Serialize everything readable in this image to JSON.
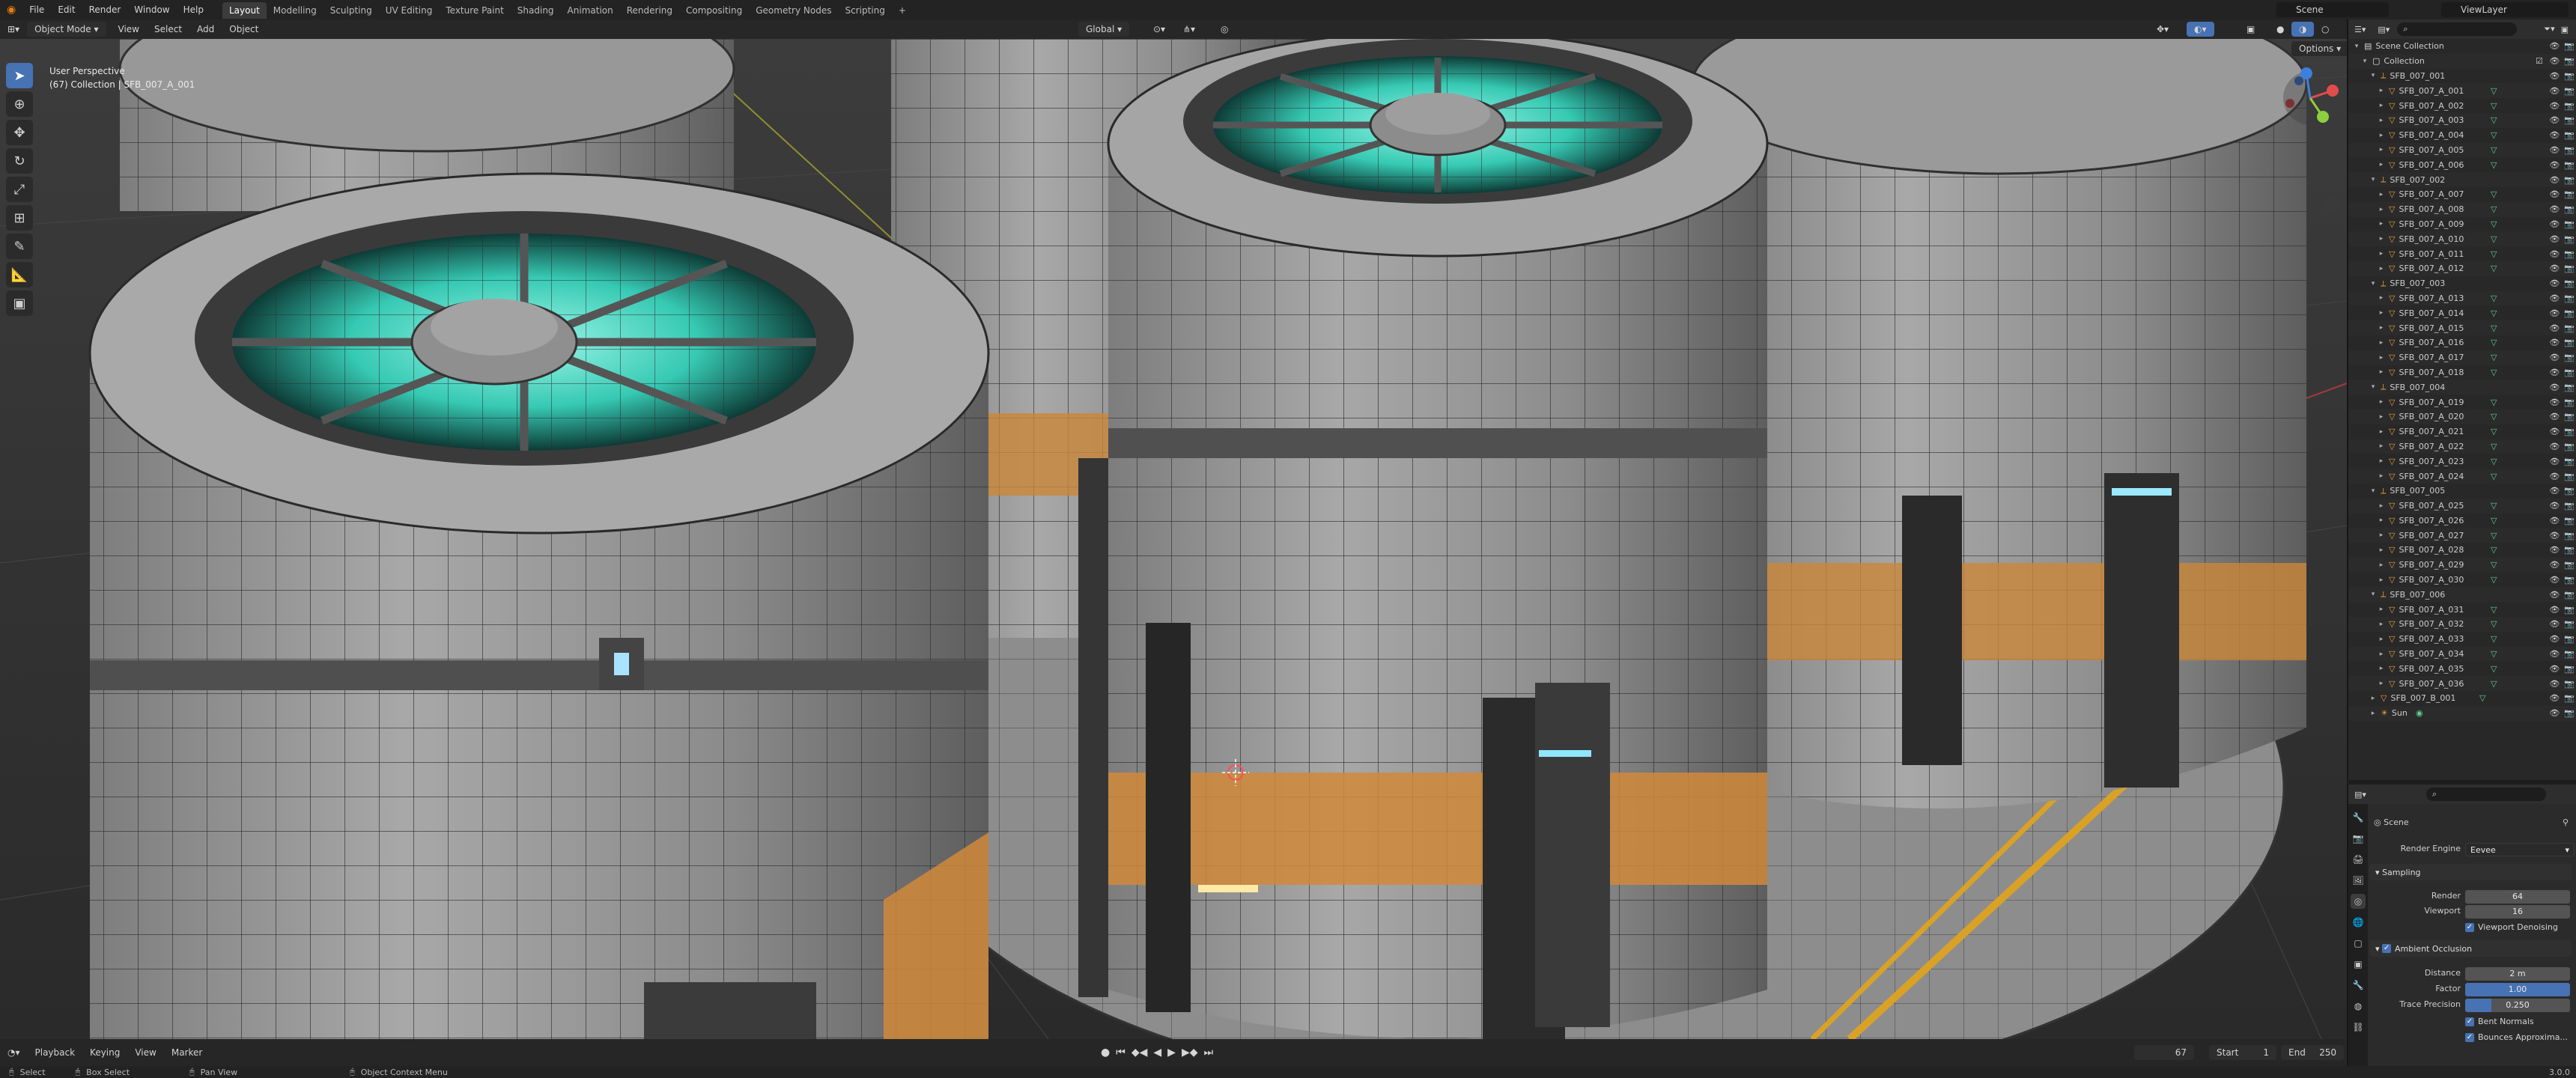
{
  "topbar": {
    "menus": [
      "File",
      "Edit",
      "Render",
      "Window",
      "Help"
    ],
    "workspaces": [
      "Layout",
      "Modelling",
      "Sculpting",
      "UV Editing",
      "Texture Paint",
      "Shading",
      "Animation",
      "Rendering",
      "Compositing",
      "Geometry Nodes",
      "Scripting"
    ],
    "active_workspace": "Layout",
    "add_workspace": "+",
    "scene": "Scene",
    "view_layer": "ViewLayer"
  },
  "viewport_header": {
    "mode": "Object Mode",
    "menus": [
      "View",
      "Select",
      "Add",
      "Object"
    ],
    "transform_orientation": "Global",
    "options": "Options"
  },
  "viewport": {
    "perspective": "User Perspective",
    "collection_info": "(67) Collection | SFB_007_A_001"
  },
  "timeline": {
    "menus": [
      "Playback",
      "Keying",
      "View",
      "Marker"
    ],
    "current_frame": "67",
    "start_label": "Start",
    "start": "1",
    "end_label": "End",
    "end": "250"
  },
  "statusbar": {
    "select": "Select",
    "box_select": "Box Select",
    "pan_view": "Pan View",
    "context_menu": "Object Context Menu",
    "version": "3.0.0"
  },
  "outliner": {
    "scene_collection": "Scene Collection",
    "collection": "Collection",
    "groups": [
      {
        "name": "SFB_007_001",
        "children": [
          "SFB_007_A_001",
          "SFB_007_A_002",
          "SFB_007_A_003",
          "SFB_007_A_004",
          "SFB_007_A_005",
          "SFB_007_A_006"
        ]
      },
      {
        "name": "SFB_007_002",
        "children": [
          "SFB_007_A_007",
          "SFB_007_A_008",
          "SFB_007_A_009",
          "SFB_007_A_010",
          "SFB_007_A_011",
          "SFB_007_A_012"
        ]
      },
      {
        "name": "SFB_007_003",
        "children": [
          "SFB_007_A_013",
          "SFB_007_A_014",
          "SFB_007_A_015",
          "SFB_007_A_016",
          "SFB_007_A_017",
          "SFB_007_A_018"
        ]
      },
      {
        "name": "SFB_007_004",
        "children": [
          "SFB_007_A_019",
          "SFB_007_A_020",
          "SFB_007_A_021",
          "SFB_007_A_022",
          "SFB_007_A_023",
          "SFB_007_A_024"
        ]
      },
      {
        "name": "SFB_007_005",
        "children": [
          "SFB_007_A_025",
          "SFB_007_A_026",
          "SFB_007_A_027",
          "SFB_007_A_028",
          "SFB_007_A_029",
          "SFB_007_A_030"
        ]
      },
      {
        "name": "SFB_007_006",
        "children": [
          "SFB_007_A_031",
          "SFB_007_A_032",
          "SFB_007_A_033",
          "SFB_007_A_034",
          "SFB_007_A_035",
          "SFB_007_A_036"
        ]
      }
    ],
    "extra": [
      "SFB_007_B_001",
      "Sun"
    ]
  },
  "properties": {
    "context": "Scene",
    "render_engine_label": "Render Engine",
    "render_engine": "Eevee",
    "sampling": "Sampling",
    "render_label": "Render",
    "render_samples": "64",
    "viewport_label": "Viewport",
    "viewport_samples": "16",
    "viewport_denoising": "Viewport Denoising",
    "ambient_occlusion": "Ambient Occlusion",
    "distance_label": "Distance",
    "distance": "2 m",
    "factor_label": "Factor",
    "factor": "1.00",
    "trace_precision_label": "Trace Precision",
    "trace_precision": "0.250",
    "bent_normals": "Bent Normals",
    "bounces": "Bounces Approxima..."
  },
  "colors": {
    "accent": "#4772b3",
    "object_orange": "#e69a3f",
    "mesh_green": "#5fcf8f",
    "rail_yellow": "#d9a227",
    "glow_teal": "#3fd9c3"
  }
}
